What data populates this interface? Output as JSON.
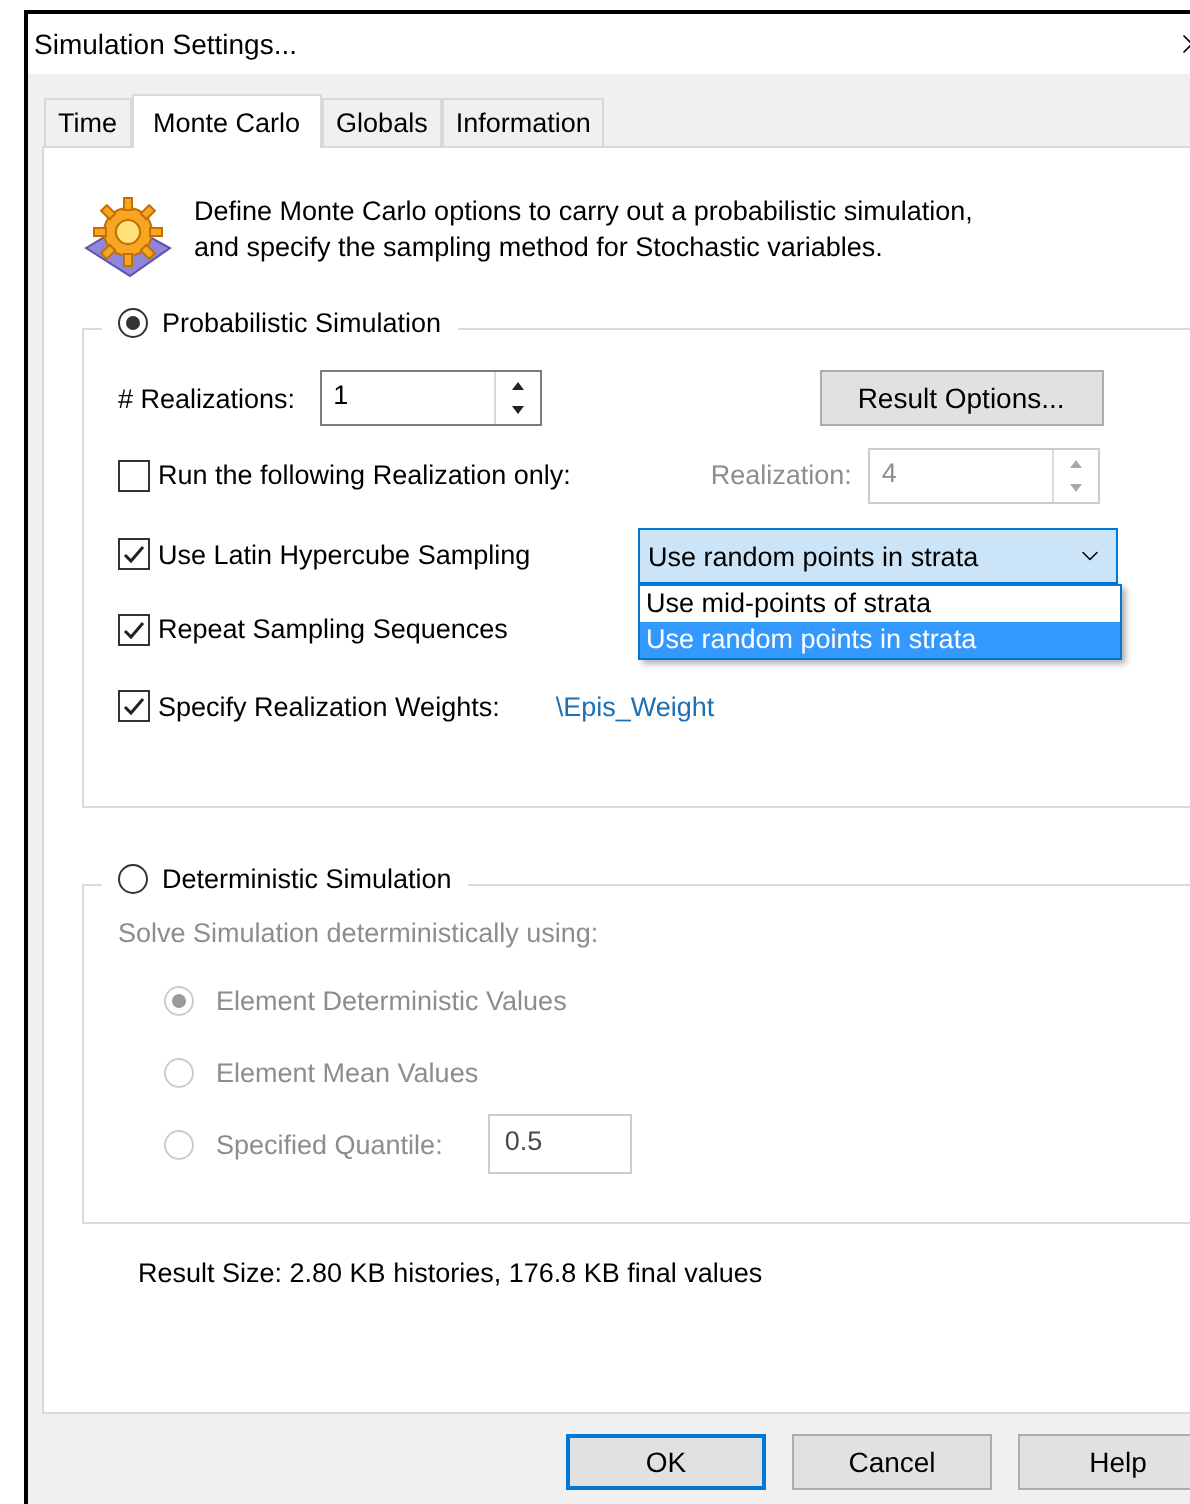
{
  "window": {
    "title": "Simulation Settings..."
  },
  "tabs": [
    {
      "label": "Time",
      "selected": false
    },
    {
      "label": "Monte Carlo",
      "selected": true
    },
    {
      "label": "Globals",
      "selected": false
    },
    {
      "label": "Information",
      "selected": false
    }
  ],
  "description": "Define Monte Carlo options to carry out a probabilistic simulation, and specify the sampling method for Stochastic variables.",
  "probabilistic": {
    "label": "Probabilistic Simulation",
    "selected": true,
    "realizations": {
      "label": "# Realizations:",
      "value": "1"
    },
    "result_options_button": "Result Options...",
    "run_only": {
      "label": "Run the following Realization only:",
      "checked": false
    },
    "realization_field": {
      "label": "Realization:",
      "value": "4",
      "disabled": true
    },
    "latin_hypercube": {
      "label": "Use Latin Hypercube Sampling",
      "checked": true,
      "dropdown": {
        "value": "Use random points in strata",
        "expanded": true,
        "options": [
          {
            "label": "Use mid-points of strata",
            "selected": false
          },
          {
            "label": "Use random points in strata",
            "selected": true
          }
        ]
      }
    },
    "repeat_sequences": {
      "label": "Repeat Sampling Sequences",
      "checked": true
    },
    "weights": {
      "label": "Specify Realization Weights:",
      "checked": true,
      "link": "\\Epis_Weight"
    }
  },
  "deterministic": {
    "label": "Deterministic Simulation",
    "selected": false,
    "disabled": true,
    "caption": "Solve Simulation deterministically using:",
    "options": [
      {
        "label": "Element Deterministic Values",
        "selected": true
      },
      {
        "label": "Element Mean Values",
        "selected": false
      },
      {
        "label": "Specified Quantile:",
        "selected": false,
        "value": "0.5"
      }
    ]
  },
  "result_size": "Result Size: 2.80 KB histories, 176.8 KB final values",
  "buttons": [
    {
      "label": "OK",
      "default": true
    },
    {
      "label": "Cancel",
      "default": false
    },
    {
      "label": "Help",
      "default": false
    }
  ]
}
